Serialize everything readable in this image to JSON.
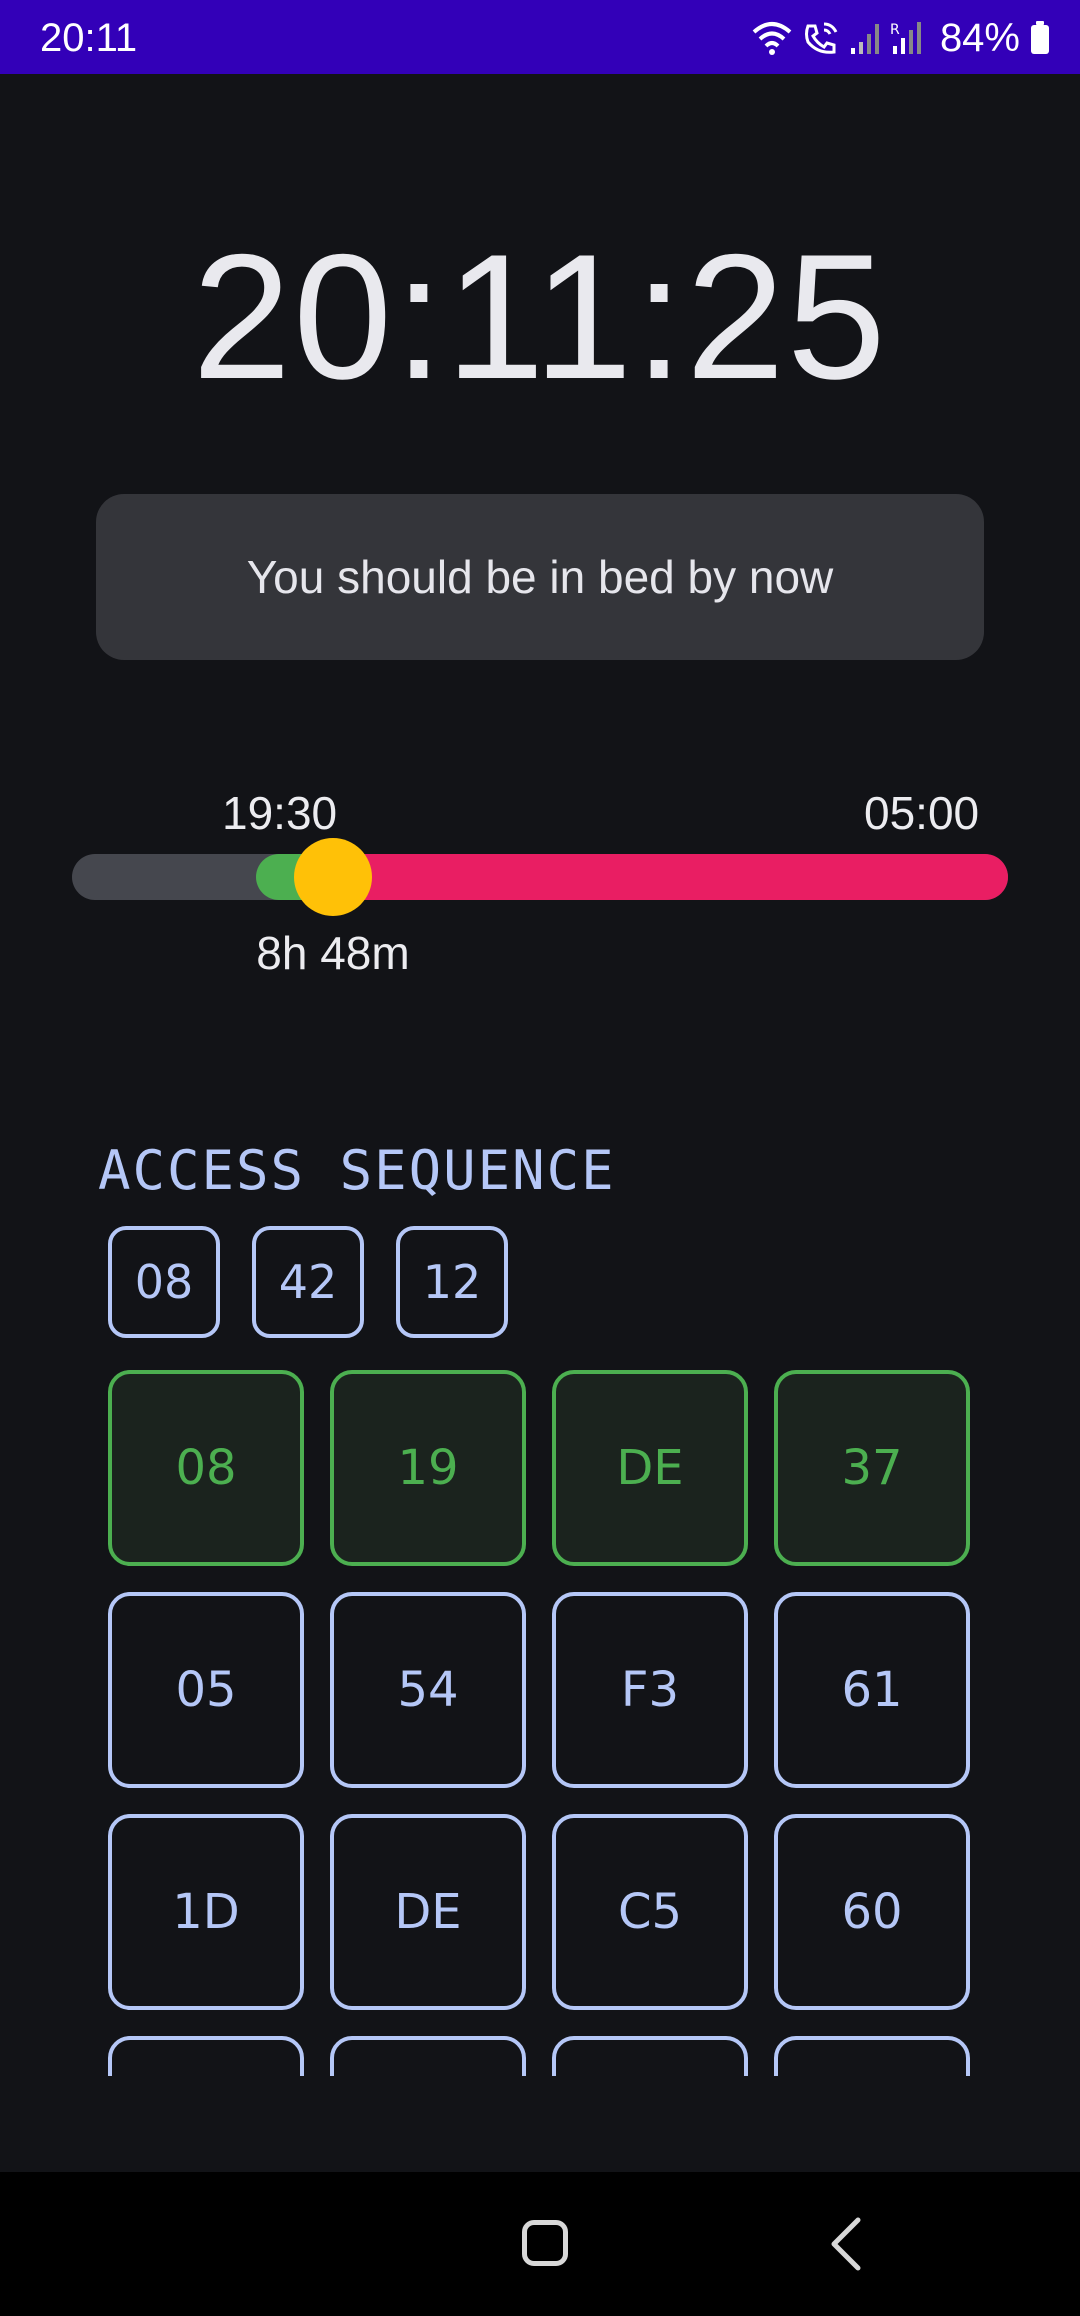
{
  "status_bar": {
    "time": "20:11",
    "battery": "84%",
    "icons": [
      "wifi-icon",
      "wifi-calling-icon",
      "signal-icon",
      "signal-roaming-icon",
      "battery-icon"
    ]
  },
  "clock": {
    "time": "20:11:25"
  },
  "message": {
    "text": "You should be in bed by now"
  },
  "sleep_range": {
    "start_label": "19:30",
    "end_label": "05:00",
    "duration_label": "8h 48m",
    "colors": {
      "track": "#45474e",
      "elapsed": "#4caf50",
      "remaining": "#e91e63",
      "thumb": "#ffc107"
    }
  },
  "access": {
    "title": "ACCESS SEQUENCE",
    "sequence": [
      "08",
      "42",
      "12"
    ],
    "grid": [
      [
        {
          "value": "08",
          "matched": true
        },
        {
          "value": "19",
          "matched": true
        },
        {
          "value": "DE",
          "matched": true
        },
        {
          "value": "37",
          "matched": true
        }
      ],
      [
        {
          "value": "05",
          "matched": false
        },
        {
          "value": "54",
          "matched": false
        },
        {
          "value": "F3",
          "matched": false
        },
        {
          "value": "61",
          "matched": false
        }
      ],
      [
        {
          "value": "1D",
          "matched": false
        },
        {
          "value": "DE",
          "matched": false
        },
        {
          "value": "C5",
          "matched": false
        },
        {
          "value": "60",
          "matched": false
        }
      ],
      [
        {
          "value": "",
          "matched": false
        },
        {
          "value": "",
          "matched": false
        },
        {
          "value": "",
          "matched": false
        },
        {
          "value": "",
          "matched": false
        }
      ]
    ],
    "colors": {
      "normal": "#b5c7f7",
      "matched": "#4caf50"
    }
  },
  "nav_bar": {
    "icons": [
      "home-icon",
      "back-icon"
    ]
  }
}
